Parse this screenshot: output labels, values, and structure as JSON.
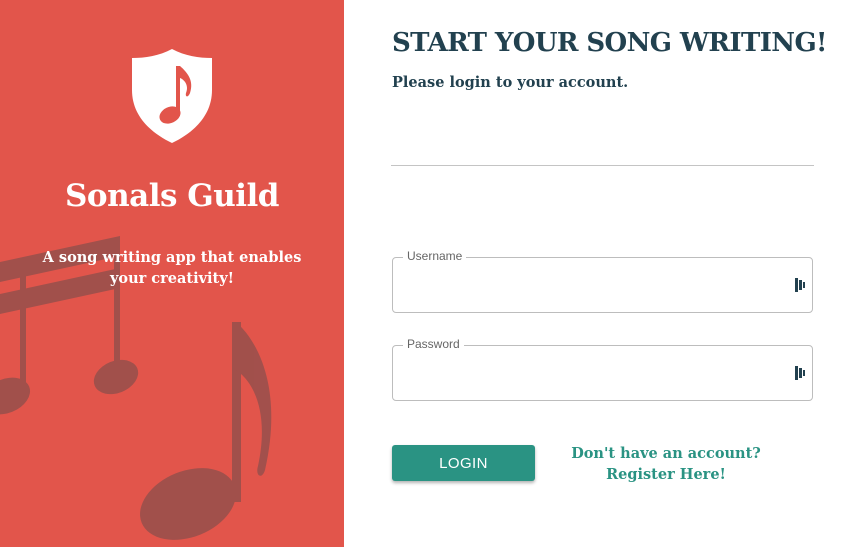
{
  "brand": {
    "name": "Sonals Guild",
    "tagline": "A song writing app that enables your creativity!",
    "logo_icon": "shield-music-note-icon",
    "background_icon": "music-notes-icon"
  },
  "form": {
    "title": "START YOUR SONG WRITING!",
    "subtitle": "Please login to your account.",
    "username_label": "Username",
    "username_value": "",
    "password_label": "Password",
    "password_value": "",
    "field_icon": "password-manager-icon",
    "login_label": "LOGIN",
    "register_link": "Don't have an account? Register Here!"
  },
  "colors": {
    "brand_panel": "#e2554b",
    "heading": "#22414f",
    "accent": "#2a9383"
  }
}
